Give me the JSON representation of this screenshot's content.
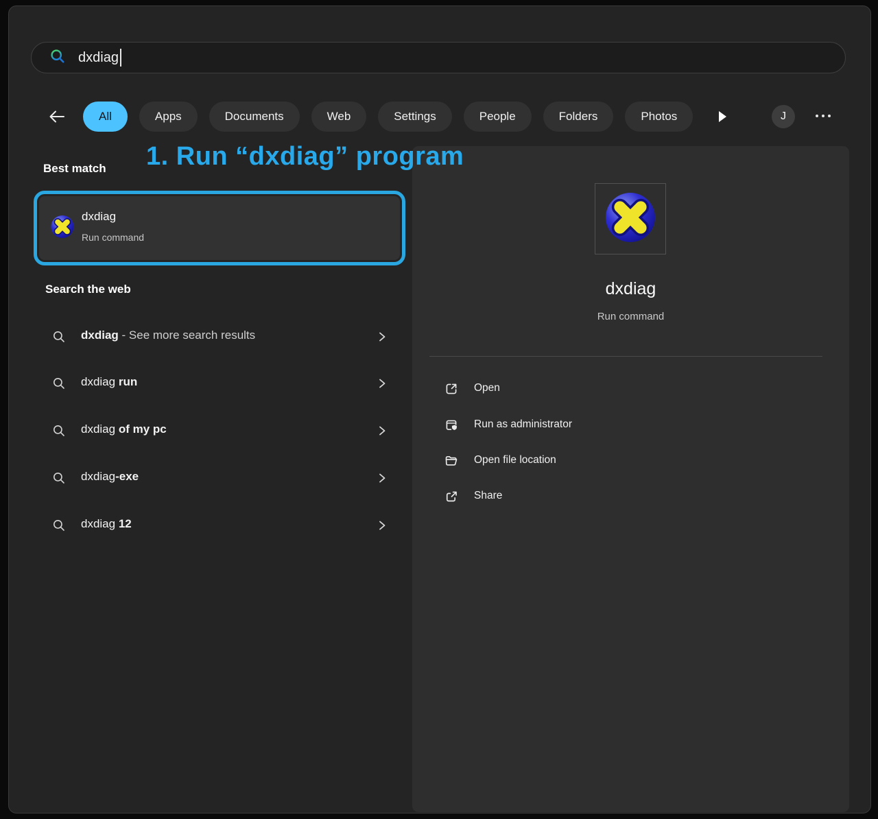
{
  "search": {
    "value": "dxdiag",
    "icon": "search-icon"
  },
  "nav": {
    "back_icon": "back-arrow-icon",
    "tabs": [
      {
        "label": "All",
        "active": true
      },
      {
        "label": "Apps",
        "active": false
      },
      {
        "label": "Documents",
        "active": false
      },
      {
        "label": "Web",
        "active": false
      },
      {
        "label": "Settings",
        "active": false
      },
      {
        "label": "People",
        "active": false
      },
      {
        "label": "Folders",
        "active": false
      },
      {
        "label": "Photos",
        "active": false
      }
    ],
    "more_tabs_icon": "play-arrow-icon",
    "avatar_initial": "J",
    "more_options_icon": "ellipsis-icon"
  },
  "annotation": {
    "step_label": "1. Run “dxdiag” program",
    "text_color": "#29a9ea",
    "highlight_border_color": "#2aa7e0"
  },
  "sections": {
    "best_match": "Best match",
    "search_the_web": "Search the web"
  },
  "best_match": {
    "title": "dxdiag",
    "subtitle": "Run command",
    "icon": "dxdiag-app-icon"
  },
  "web_suggestions": [
    {
      "part1": "dxdiag",
      "part2": " - See more search results",
      "bold_part": "part1"
    },
    {
      "part1": "dxdiag ",
      "part2": "run",
      "bold_part": "part2"
    },
    {
      "part1": "dxdiag ",
      "part2": "of my pc",
      "bold_part": "part2"
    },
    {
      "part1": "dxdiag",
      "part2": "-exe",
      "bold_part": "part2"
    },
    {
      "part1": "dxdiag ",
      "part2": "12",
      "bold_part": "part2"
    }
  ],
  "preview": {
    "title": "dxdiag",
    "subtitle": "Run command",
    "icon": "dxdiag-app-icon",
    "actions": [
      {
        "label": "Open",
        "icon": "open-external-icon"
      },
      {
        "label": "Run as administrator",
        "icon": "run-admin-shield-icon"
      },
      {
        "label": "Open file location",
        "icon": "folder-icon"
      },
      {
        "label": "Share",
        "icon": "share-icon"
      }
    ]
  },
  "colors": {
    "active_pill": "#4cc2ff",
    "annotation_blue": "#29a9ea",
    "highlight_border": "#2aa7e0",
    "window_bg": "#242424",
    "panel_bg": "#2e2e2e",
    "dxdiag_icon_blue": "#2424c8",
    "dxdiag_icon_yellow": "#f0e42a"
  }
}
